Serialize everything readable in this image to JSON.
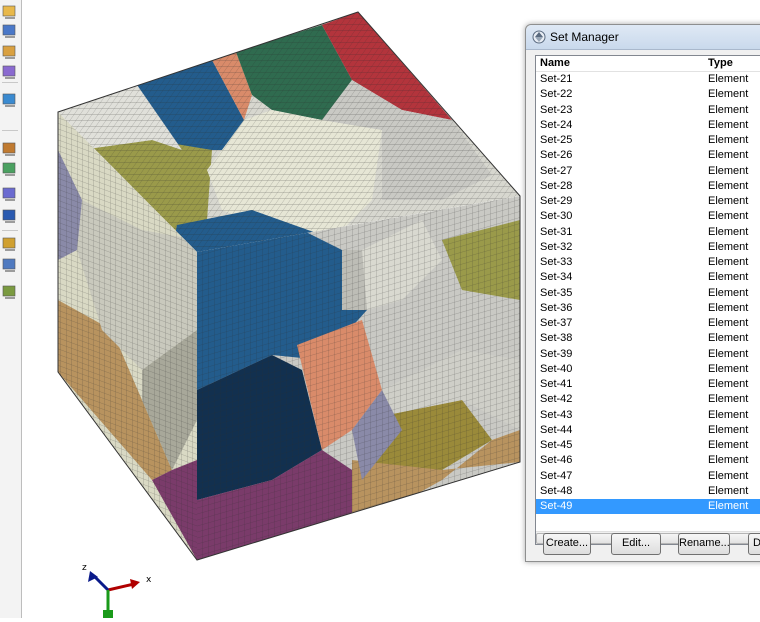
{
  "set_manager": {
    "title": "Set Manager",
    "columns": {
      "name": "Name",
      "type": "Type"
    },
    "rows": [
      {
        "name": "Set-21",
        "type": "Element"
      },
      {
        "name": "Set-22",
        "type": "Element"
      },
      {
        "name": "Set-23",
        "type": "Element"
      },
      {
        "name": "Set-24",
        "type": "Element"
      },
      {
        "name": "Set-25",
        "type": "Element"
      },
      {
        "name": "Set-26",
        "type": "Element"
      },
      {
        "name": "Set-27",
        "type": "Element"
      },
      {
        "name": "Set-28",
        "type": "Element"
      },
      {
        "name": "Set-29",
        "type": "Element"
      },
      {
        "name": "Set-30",
        "type": "Element"
      },
      {
        "name": "Set-31",
        "type": "Element"
      },
      {
        "name": "Set-32",
        "type": "Element"
      },
      {
        "name": "Set-33",
        "type": "Element"
      },
      {
        "name": "Set-34",
        "type": "Element"
      },
      {
        "name": "Set-35",
        "type": "Element"
      },
      {
        "name": "Set-36",
        "type": "Element"
      },
      {
        "name": "Set-37",
        "type": "Element"
      },
      {
        "name": "Set-38",
        "type": "Element"
      },
      {
        "name": "Set-39",
        "type": "Element"
      },
      {
        "name": "Set-40",
        "type": "Element"
      },
      {
        "name": "Set-41",
        "type": "Element"
      },
      {
        "name": "Set-42",
        "type": "Element"
      },
      {
        "name": "Set-43",
        "type": "Element"
      },
      {
        "name": "Set-44",
        "type": "Element"
      },
      {
        "name": "Set-45",
        "type": "Element"
      },
      {
        "name": "Set-46",
        "type": "Element"
      },
      {
        "name": "Set-47",
        "type": "Element"
      },
      {
        "name": "Set-48",
        "type": "Element"
      },
      {
        "name": "Set-49",
        "type": "Element"
      }
    ],
    "selected_row": "Set-49",
    "scroll_grip": "|||",
    "buttons": {
      "create": "Create...",
      "edit": "Edit...",
      "rename": "Rename...",
      "delete": "D"
    }
  },
  "triad": {
    "x_label": "x",
    "y_label": "",
    "z_label": "z"
  },
  "colors": {
    "selection": "#3399ff",
    "mesh_line": "#2b2b2b",
    "grain_blue": "#235c8c",
    "grain_navy": "#12304f",
    "grain_green": "#2f6b4f",
    "grain_red": "#b3343c",
    "grain_olive": "#9a9a4a",
    "grain_purple": "#7a3b6a",
    "grain_tan": "#b8935f",
    "grain_salmon": "#d98b6a",
    "grain_light": "#d9d9c4"
  },
  "toolbox_icons": [
    "view-grid-icon",
    "part-tools-icon",
    "extrude-icon",
    "partition-icon",
    "datum-icon",
    "mesh-seed-icon",
    "mesh-element-icon",
    "csys-icon",
    "axis-triad-icon",
    "assign-icon",
    "query-icon",
    "tools-icon",
    "sweep-icon"
  ]
}
